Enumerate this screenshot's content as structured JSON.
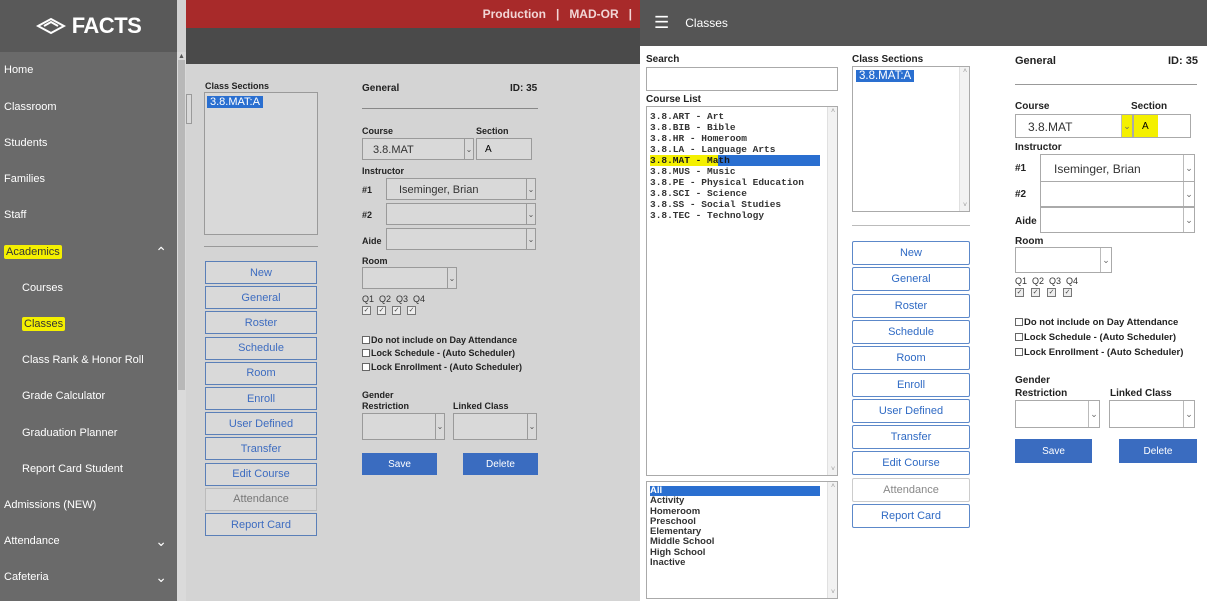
{
  "left": {
    "logo_text": "FACTS",
    "topbar": {
      "env": "Production",
      "sep1": "|",
      "school": "MAD-OR",
      "sep2": "|"
    },
    "nav": [
      {
        "label": "Home",
        "sub": false
      },
      {
        "label": "Classroom",
        "sub": false
      },
      {
        "label": "Students",
        "sub": false
      },
      {
        "label": "Families",
        "sub": false
      },
      {
        "label": "Staff",
        "sub": false
      },
      {
        "label": "Academics",
        "sub": false,
        "highlight": true,
        "chevron": "^"
      },
      {
        "label": "Courses",
        "sub": true
      },
      {
        "label": "Classes",
        "sub": true,
        "highlight": true
      },
      {
        "label": "Class Rank & Honor Roll",
        "sub": true
      },
      {
        "label": "Grade Calculator",
        "sub": true
      },
      {
        "label": "Graduation Planner",
        "sub": true
      },
      {
        "label": "Report Card Student",
        "sub": true
      },
      {
        "label": "Admissions (NEW)",
        "sub": false
      },
      {
        "label": "Attendance",
        "sub": false,
        "chevron": "v"
      },
      {
        "label": "Cafeteria",
        "sub": false,
        "chevron": "v"
      }
    ],
    "class_sections_label": "Class Sections",
    "selected_section": "3.8.MAT:A",
    "buttons": [
      "New",
      "General",
      "Roster",
      "Schedule",
      "Room",
      "Enroll",
      "User Defined",
      "Transfer",
      "Edit Course",
      "Attendance",
      "Report Card"
    ],
    "general": "General",
    "id": "ID: 35",
    "course_label": "Course",
    "section_label": "Section",
    "course_value": "3.8.MAT",
    "section_value": "A",
    "instructor_label": "Instructor",
    "n1": "#1",
    "n2": "#2",
    "aide": "Aide",
    "instructor_value": "Iseminger, Brian",
    "room_label": "Room",
    "quarters": "Q1  Q2  Q3  Q4",
    "checks": [
      "Do not include on Day Attendance",
      "Lock Schedule - (Auto Scheduler)",
      "Lock Enrollment - (Auto Scheduler)"
    ],
    "gender_label": "Gender",
    "restriction_label": "Restriction",
    "linked_label": "Linked Class",
    "save": "Save",
    "delete": "Delete"
  },
  "right": {
    "header_title": "Classes",
    "search_label": "Search",
    "course_list_label": "Course List",
    "courses": [
      "3.8.ART - Art",
      "3.8.BIB - Bible",
      "3.8.HR - Homeroom",
      "3.8.LA - Language Arts",
      "3.8.MAT - Math",
      "3.8.MUS - Music",
      "3.8.PE - Physical Education",
      "3.8.SCI - Science",
      "3.8.SS - Social Studies",
      "3.8.TEC - Technology"
    ],
    "selected_course_index": 4,
    "filters": [
      "All",
      "Activity",
      "Homeroom",
      "Preschool",
      "Elementary",
      "Middle School",
      "High School",
      "Inactive"
    ],
    "class_sections_label": "Class Sections",
    "selected_section": "3.8.MAT:A",
    "buttons": [
      "New",
      "General",
      "Roster",
      "Schedule",
      "Room",
      "Enroll",
      "User Defined",
      "Transfer",
      "Edit Course",
      "Attendance",
      "Report Card"
    ],
    "general": "General",
    "id": "ID: 35",
    "course_label": "Course",
    "section_label": "Section",
    "course_value": "3.8.MAT",
    "section_value": "A",
    "instructor_label": "Instructor",
    "n1": "#1",
    "n2": "#2",
    "aide": "Aide",
    "instructor_value": "Iseminger, Brian",
    "room_label": "Room",
    "quarters": "Q1  Q2  Q3  Q4",
    "checks": [
      "Do not include on Day Attendance",
      "Lock Schedule - (Auto Scheduler)",
      "Lock Enrollment - (Auto Scheduler)"
    ],
    "gender_label": "Gender",
    "restriction_label": "Restriction",
    "linked_label": "Linked Class",
    "save": "Save",
    "delete": "Delete"
  },
  "colors": {
    "highlight": "#f4f000",
    "accent": "#3a6cc0",
    "selection": "#2a6fd0",
    "topbar_red": "#a82a2a"
  }
}
